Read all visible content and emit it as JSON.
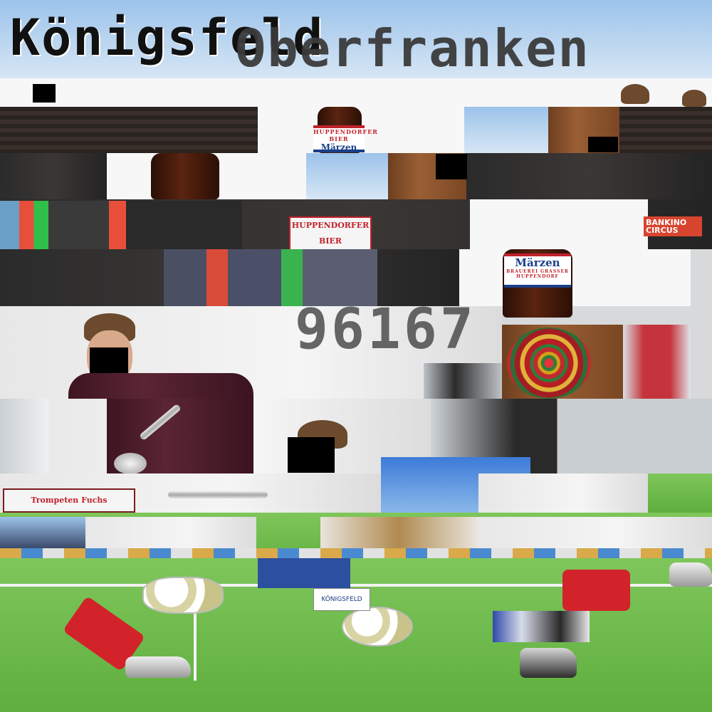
{
  "title": "Königsfeld",
  "region": "Oberfranken",
  "postcode": "96167",
  "beer_label": {
    "brand": "HUPPENDORFER BIER",
    "name": "Märzen",
    "brewery": "BRAUEREI GRASSER HUPPENDORF"
  },
  "banner_text": "HUPPENDORFER BIER",
  "circus_sign": "BANKINO CIRCUS",
  "trumpet_poster": "Trompeten Fuchs",
  "podium_sign": "KÖNIGSFELD",
  "colors": {
    "grass": "#6cbc4a",
    "sock_red": "#d2232a",
    "label_blue": "#1a3f8a",
    "label_red": "#c0222b",
    "censor": "#000000"
  }
}
